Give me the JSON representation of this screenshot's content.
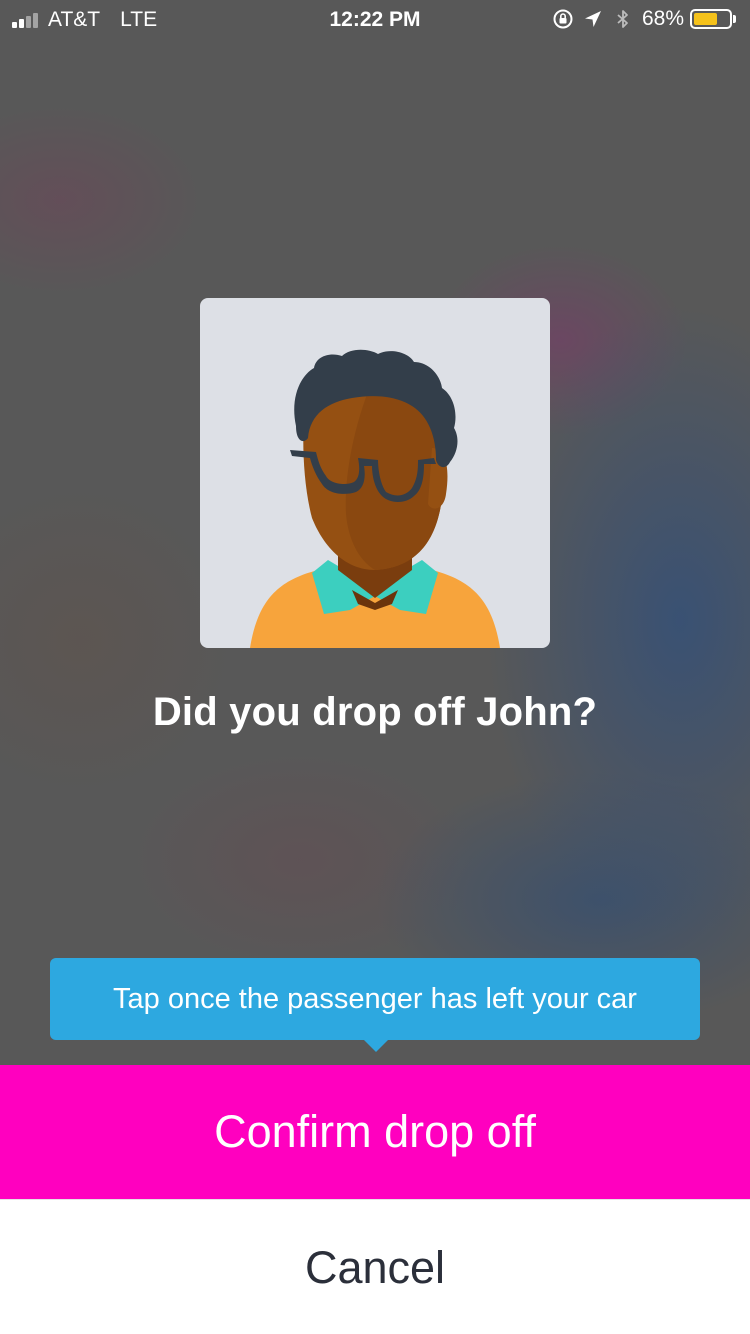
{
  "status_bar": {
    "carrier": "AT&T",
    "network": "LTE",
    "time": "12:22 PM",
    "battery_percent": "68%",
    "battery_level": 0.68,
    "battery_color": "#f5c21b",
    "icons": [
      "signal-icon",
      "rotation-lock-icon",
      "location-icon",
      "bluetooth-icon",
      "battery-icon"
    ]
  },
  "avatar": {
    "icon": "passenger-avatar-illustration",
    "background_color": "#dde0e6"
  },
  "question": "Did you drop off John?",
  "tooltip": {
    "text": "Tap once the passenger has left your car",
    "color": "#2da8e0"
  },
  "actions": {
    "confirm_label": "Confirm drop off",
    "confirm_color": "#ff00bf",
    "cancel_label": "Cancel"
  }
}
